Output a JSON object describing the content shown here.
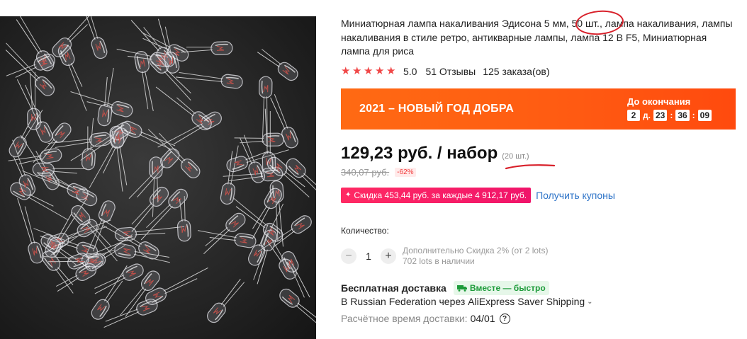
{
  "product": {
    "title_part1": "Миниатюрная лампа накаливания Эдисона 5 мм, ",
    "title_highlight": "50 шт.",
    "title_part2": ", лампа накаливания, лампы накаливания в стиле ретро, антикварные лампы, лампа 12 В F5, Миниатюрная лампа для риса",
    "rating_value": "5.0",
    "reviews": "51 Отзывы",
    "orders": "125 заказа(ов)",
    "star_count": 5
  },
  "banner": {
    "title": "2021 – НОВЫЙ ГОД ДОБРА",
    "countdown_label": "До окончания",
    "days": "2",
    "days_suffix": "д.",
    "hours": "23",
    "minutes": "36",
    "seconds": "09",
    "colon": ":"
  },
  "price": {
    "current": "129,23 руб. / набор",
    "unit": "(20 шт.)",
    "old": "340,07 руб.",
    "discount": "-62%"
  },
  "coupon": {
    "badge": "Скидка 453,44 руб. за каждые 4 912,17 руб.",
    "link": "Получить купоны",
    "spark": "✦"
  },
  "quantity": {
    "label": "Количество:",
    "value": "1",
    "minus": "−",
    "plus": "+",
    "extra_discount": "Дополнительно Скидка 2% (от 2 lots)",
    "available": "702 lots в наличии"
  },
  "shipping": {
    "title": "Бесплатная доставка",
    "fast_badge": "Вместе — быстро",
    "route": "В Russian Federation через AliExpress Saver Shipping",
    "chevron": "⌄",
    "delivery_label": "Расчётное время доставки:",
    "delivery_date": "04/01",
    "help": "?"
  },
  "colors": {
    "accent": "#ff5a12",
    "star": "#f04747",
    "link": "#2e74c8",
    "coupon": "#f0146a",
    "annotation": "#d8202a"
  },
  "icons": [
    "star-icon",
    "minus-icon",
    "plus-icon",
    "truck-icon",
    "help-icon",
    "chevron-down-icon"
  ]
}
